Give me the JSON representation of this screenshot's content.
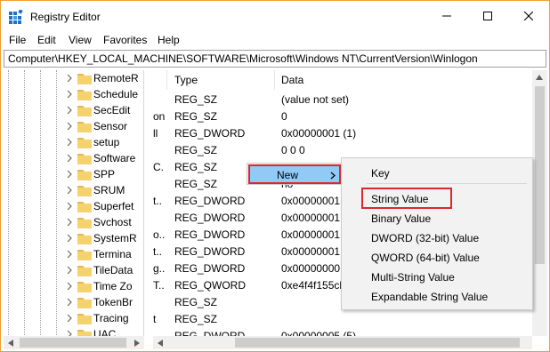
{
  "window": {
    "title": "Registry Editor",
    "accent_border": "#f0a030"
  },
  "menubar": [
    "File",
    "Edit",
    "View",
    "Favorites",
    "Help"
  ],
  "address": "Computer\\HKEY_LOCAL_MACHINE\\SOFTWARE\\Microsoft\\Windows NT\\CurrentVersion\\Winlogon",
  "tree": {
    "items": [
      "RemoteR",
      "Schedule",
      "SecEdit",
      "Sensor",
      "setup",
      "Software",
      "SPP",
      "SRUM",
      "Superfet",
      "Svchost",
      "SystemR",
      "Termina",
      "TileData",
      "Time Zo",
      "TokenBr",
      "Tracing",
      "UAC"
    ]
  },
  "values": {
    "columns": {
      "type": "Type",
      "data": "Data"
    },
    "rows": [
      {
        "name": "",
        "type": "REG_SZ",
        "data": "(value not set)"
      },
      {
        "name": "on",
        "type": "REG_SZ",
        "data": "0"
      },
      {
        "name": "ll",
        "type": "REG_DWORD",
        "data": "0x00000001 (1)"
      },
      {
        "name": "",
        "type": "REG_SZ",
        "data": "0 0 0"
      },
      {
        "name": "C.",
        "type": "REG_SZ",
        "data": ""
      },
      {
        "name": "",
        "type": "REG_SZ",
        "data": "no"
      },
      {
        "name": "t..",
        "type": "REG_DWORD",
        "data": "0x00000001 ("
      },
      {
        "name": "",
        "type": "REG_DWORD",
        "data": "0x00000001 ("
      },
      {
        "name": "o..",
        "type": "REG_DWORD",
        "data": "0x00000001 ("
      },
      {
        "name": "t..",
        "type": "REG_DWORD",
        "data": "0x00000001 ("
      },
      {
        "name": "g..",
        "type": "REG_DWORD",
        "data": "0x00000000 ("
      },
      {
        "name": "T..",
        "type": "REG_QWORD",
        "data": "0xe4f4f155cb"
      },
      {
        "name": "",
        "type": "REG_SZ",
        "data": ""
      },
      {
        "name": "t",
        "type": "REG_SZ",
        "data": ""
      },
      {
        "name": "",
        "type": "REG_DWORD",
        "data": "0x00000005 (5)"
      }
    ]
  },
  "context_menu": {
    "new_label": "New",
    "highlight_color": "#91c9f7",
    "annotation_color": "#d9282e"
  },
  "submenu": {
    "items": [
      "Key",
      "String Value",
      "Binary Value",
      "DWORD (32-bit) Value",
      "QWORD (64-bit) Value",
      "Multi-String Value",
      "Expandable String Value"
    ]
  }
}
